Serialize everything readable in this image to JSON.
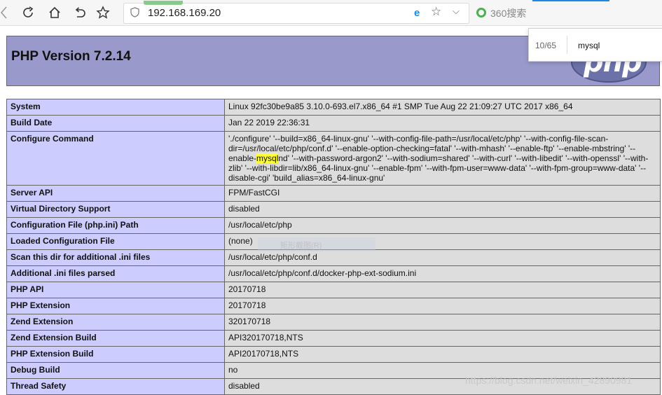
{
  "browser": {
    "url": "192.168.169.20",
    "search_placeholder": "360搜索",
    "icons": [
      "refresh-icon",
      "home-icon",
      "undo-icon",
      "star-icon",
      "shield-icon",
      "ie-icon",
      "chevron-down-icon"
    ]
  },
  "find_bar": {
    "count": "10/65",
    "query": "mysql"
  },
  "php": {
    "title": "PHP Version 7.2.14",
    "logo_text": "php"
  },
  "rows": [
    {
      "key": "System",
      "value": "Linux 92fc30be9a85 3.10.0-693.el7.x86_64 #1 SMP Tue Aug 22 21:09:27 UTC 2017 x86_64"
    },
    {
      "key": "Build Date",
      "value": "Jan 22 2019 22:36:31"
    },
    {
      "key": "Configure Command",
      "value_before": "'./configure' '--build=x86_64-linux-gnu' '--with-config-file-path=/usr/local/etc/php' '--with-config-file-scan-dir=/usr/local/etc/php/conf.d' '--enable-option-checking=fatal' '--with-mhash' '--enable-ftp' '--enable-mbstring' '--enable-",
      "value_highlight": "mysql",
      "value_after": "nd' '--with-password-argon2' '--with-sodium=shared' '--with-curl' '--with-libedit' '--with-openssl' '--with-zlib' '--with-libdir=lib/x86_64-linux-gnu' '--enable-fpm' '--with-fpm-user=www-data' '--with-fpm-group=www-data' '--disable-cgi' 'build_alias=x86_64-linux-gnu'"
    },
    {
      "key": "Server API",
      "value": "FPM/FastCGI"
    },
    {
      "key": "Virtual Directory Support",
      "value": "disabled"
    },
    {
      "key": "Configuration File (php.ini) Path",
      "value": "/usr/local/etc/php"
    },
    {
      "key": "Loaded Configuration File",
      "value": "(none)"
    },
    {
      "key": "Scan this dir for additional .ini files",
      "value": "/usr/local/etc/php/conf.d"
    },
    {
      "key": "Additional .ini files parsed",
      "value": "/usr/local/etc/php/conf.d/docker-php-ext-sodium.ini"
    },
    {
      "key": "PHP API",
      "value": "20170718"
    },
    {
      "key": "PHP Extension",
      "value": "20170718"
    },
    {
      "key": "Zend Extension",
      "value": "320170718"
    },
    {
      "key": "Zend Extension Build",
      "value": "API320170718,NTS"
    },
    {
      "key": "PHP Extension Build",
      "value": "API20170718,NTS"
    },
    {
      "key": "Debug Build",
      "value": "no"
    },
    {
      "key": "Thread Safety",
      "value": "disabled"
    }
  ],
  "ghost_menu": "矩形截图(R)",
  "watermark": "https://blog.csdn.net/weixin_42890981"
}
